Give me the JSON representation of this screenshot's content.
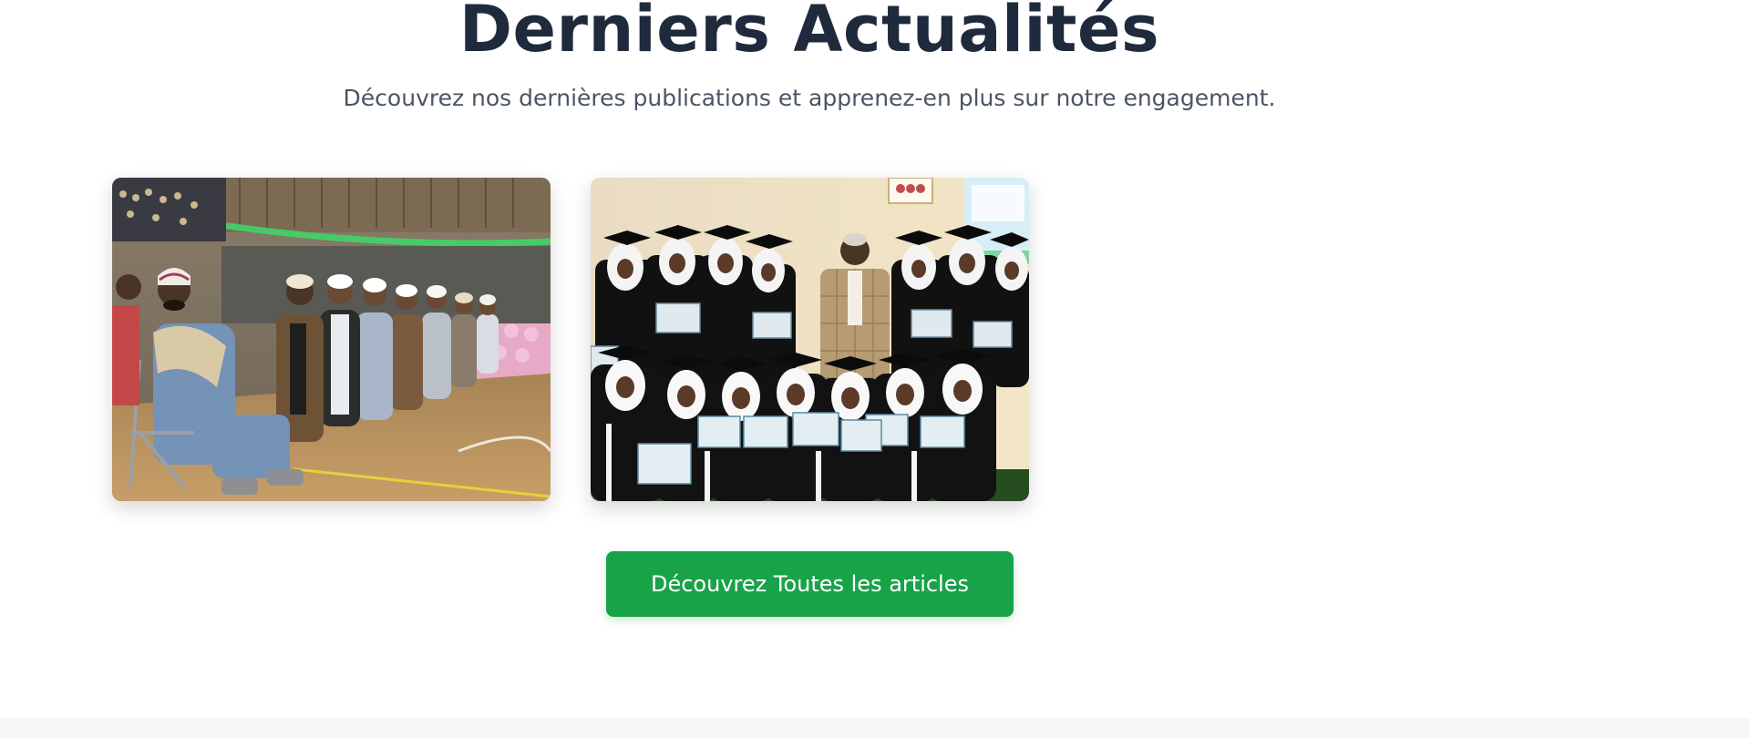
{
  "news": {
    "title": "Derniers Actualités",
    "subtitle": "Découvrez nos dernières publications et apprenez-en plus sur notre engagement.",
    "cta_label": "Découvrez Toutes les articles",
    "cards": [
      {
        "image": "seated-scholars-ceremony-photo"
      },
      {
        "image": "graduates-holding-certificates-photo"
      }
    ]
  },
  "colors": {
    "title": "#1f2a3d",
    "subtitle": "#4b5563",
    "button": "#18a348",
    "footer": "#f5f6f8"
  }
}
